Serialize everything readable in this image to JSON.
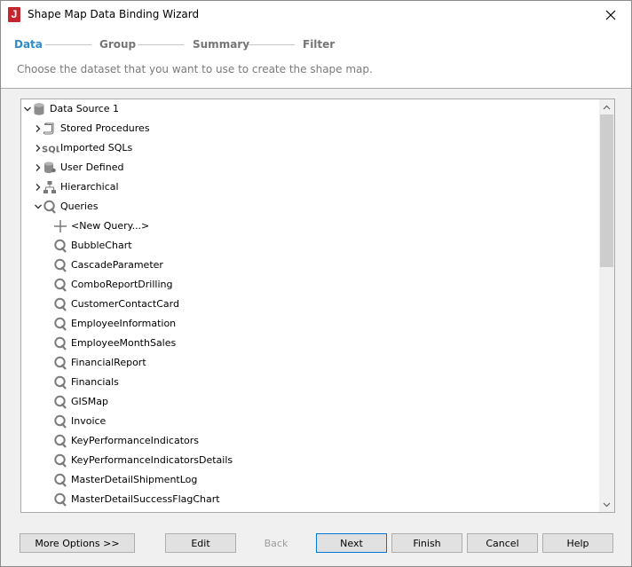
{
  "window": {
    "title": "Shape Map Data Binding Wizard",
    "app_icon_letter": "J"
  },
  "steps": [
    {
      "label": "Data",
      "active": true
    },
    {
      "label": "Group",
      "active": false
    },
    {
      "label": "Summary",
      "active": false
    },
    {
      "label": "Filter",
      "active": false
    }
  ],
  "subtitle": "Choose the dataset that you want to use to create the shape map.",
  "tree": {
    "root": {
      "label": "Data Source 1",
      "icon": "database-icon",
      "expanded": true
    },
    "folders": [
      {
        "label": "Stored Procedures",
        "icon": "scroll-icon",
        "expanded": false
      },
      {
        "label": "Imported SQLs",
        "icon": "sql-icon",
        "expanded": false
      },
      {
        "label": "User Defined",
        "icon": "database-icon",
        "expanded": false
      },
      {
        "label": "Hierarchical",
        "icon": "hierarchy-icon",
        "expanded": false
      },
      {
        "label": "Queries",
        "icon": "query-icon",
        "expanded": true
      }
    ],
    "new_query": "<New Query...>",
    "queries": [
      "BubbleChart",
      "CascadeParameter",
      "ComboReportDrilling",
      "CustomerContactCard",
      "EmployeeInformation",
      "EmployeeMonthSales",
      "FinancialReport",
      "Financials",
      "GISMap",
      "Invoice",
      "KeyPerformanceIndicators",
      "KeyPerformanceIndicatorsDetails",
      "MasterDetailShipmentLog",
      "MasterDetailSuccessFlagChart"
    ]
  },
  "buttons": {
    "more_options": "More Options >>",
    "edit": "Edit",
    "back": "Back",
    "next": "Next",
    "finish": "Finish",
    "cancel": "Cancel",
    "help": "Help"
  }
}
